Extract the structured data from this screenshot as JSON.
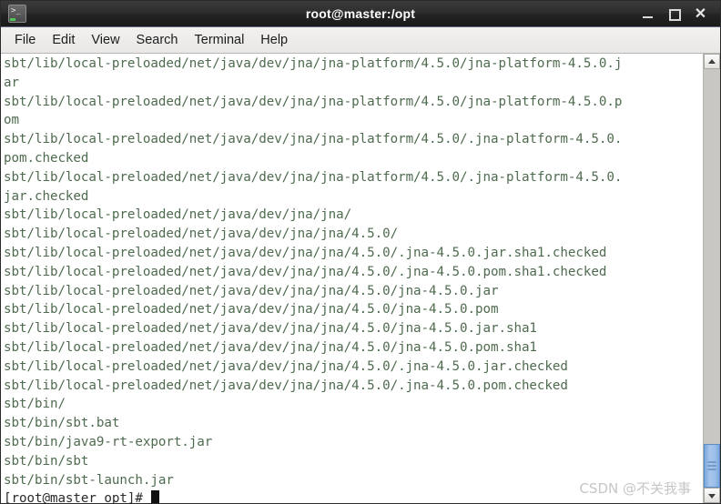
{
  "window": {
    "title": "root@master:/opt",
    "icon": "terminal-icon",
    "controls": {
      "minimize": "_",
      "maximize": "□",
      "close": "✕"
    }
  },
  "menubar": {
    "items": [
      {
        "label": "File"
      },
      {
        "label": "Edit"
      },
      {
        "label": "View"
      },
      {
        "label": "Search"
      },
      {
        "label": "Terminal"
      },
      {
        "label": "Help"
      }
    ]
  },
  "terminal": {
    "foreground": "#4f6b4f",
    "background": "#ffffff",
    "prompt_color": "#2a2a2a",
    "lines": [
      "sbt/lib/local-preloaded/net/java/dev/jna/jna-platform/4.5.0/jna-platform-4.5.0.j",
      "ar",
      "sbt/lib/local-preloaded/net/java/dev/jna/jna-platform/4.5.0/jna-platform-4.5.0.p",
      "om",
      "sbt/lib/local-preloaded/net/java/dev/jna/jna-platform/4.5.0/.jna-platform-4.5.0.",
      "pom.checked",
      "sbt/lib/local-preloaded/net/java/dev/jna/jna-platform/4.5.0/.jna-platform-4.5.0.",
      "jar.checked",
      "sbt/lib/local-preloaded/net/java/dev/jna/jna/",
      "sbt/lib/local-preloaded/net/java/dev/jna/jna/4.5.0/",
      "sbt/lib/local-preloaded/net/java/dev/jna/jna/4.5.0/.jna-4.5.0.jar.sha1.checked",
      "sbt/lib/local-preloaded/net/java/dev/jna/jna/4.5.0/.jna-4.5.0.pom.sha1.checked",
      "sbt/lib/local-preloaded/net/java/dev/jna/jna/4.5.0/jna-4.5.0.jar",
      "sbt/lib/local-preloaded/net/java/dev/jna/jna/4.5.0/jna-4.5.0.pom",
      "sbt/lib/local-preloaded/net/java/dev/jna/jna/4.5.0/jna-4.5.0.jar.sha1",
      "sbt/lib/local-preloaded/net/java/dev/jna/jna/4.5.0/jna-4.5.0.pom.sha1",
      "sbt/lib/local-preloaded/net/java/dev/jna/jna/4.5.0/.jna-4.5.0.jar.checked",
      "sbt/lib/local-preloaded/net/java/dev/jna/jna/4.5.0/.jna-4.5.0.pom.checked",
      "sbt/bin/",
      "sbt/bin/sbt.bat",
      "sbt/bin/java9-rt-export.jar",
      "sbt/bin/sbt",
      "sbt/bin/sbt-launch.jar"
    ],
    "prompt": "[root@master opt]# "
  },
  "scrollbar": {
    "up_arrow": "scroll-up-arrow",
    "down_arrow": "scroll-down-arrow",
    "thumb_position": "bottom",
    "thumb_color": "#9dc0e8"
  },
  "watermark": {
    "text": "CSDN @不关我事"
  }
}
